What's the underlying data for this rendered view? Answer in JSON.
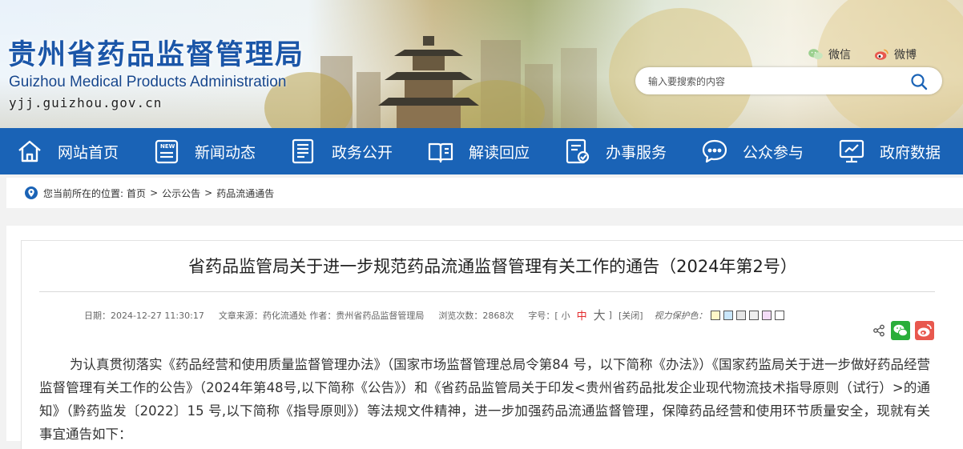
{
  "header": {
    "site_title": "贵州省药品监督管理局",
    "site_subtitle": "Guizhou Medical Products Administration",
    "site_domain": "yjj.guizhou.gov.cn",
    "wechat_label": "微信",
    "weibo_label": "微博",
    "search_placeholder": "输入要搜索的内容"
  },
  "nav": {
    "items": [
      {
        "label": "网站首页",
        "icon": "home-icon"
      },
      {
        "label": "新闻动态",
        "icon": "news-icon"
      },
      {
        "label": "政务公开",
        "icon": "document-icon"
      },
      {
        "label": "解读回应",
        "icon": "book-icon"
      },
      {
        "label": "办事服务",
        "icon": "service-icon"
      },
      {
        "label": "公众参与",
        "icon": "chat-icon"
      },
      {
        "label": "政府数据",
        "icon": "data-icon"
      }
    ]
  },
  "breadcrumb": {
    "prefix": "您当前所在的位置:",
    "items": [
      "首页",
      "公示公告",
      "药品流通通告"
    ],
    "separator": ">"
  },
  "article": {
    "title": "省药品监管局关于进一步规范药品流通监督管理有关工作的通告（2024年第2号）",
    "date": "日期：2024-12-27 11:30:17",
    "source": "文章来源：药化流通处 作者：贵州省药品监督管理局",
    "views": "浏览次数：2868次",
    "font_size_label": "字号：[",
    "font_small": "小",
    "font_medium": "中",
    "font_large": "大",
    "font_close": "]",
    "close_label": "[关闭]",
    "eye_protect_label": "视力保护色：",
    "swatch_colors": [
      "#fff6c8",
      "#c9e6fb",
      "#e6e6e6",
      "#eeeeee",
      "#f4dcf7",
      "#ffffff"
    ],
    "body": "为认真贯彻落实《药品经营和使用质量监督管理办法》（国家市场监督管理总局令第84 号，以下简称《办法》）《国家药监局关于进一步做好药品经营监督管理有关工作的公告》（2024年第48号,以下简称《公告》）和《省药品监管局关于印发<贵州省药品批发企业现代物流技术指导原则（试行）>的通知》（黔药监发〔2022〕15 号,以下简称《指导原则》）等法规文件精神，进一步加强药品流通监督管理，保障药品经营和使用环节质量安全，现就有关事宜通告如下："
  },
  "colors": {
    "nav_bg": "#1a63b6",
    "title_blue": "#1b56a8",
    "accent_red": "#e3292b",
    "wechat_green": "#2aae3a",
    "weibo_red": "#e8584e"
  }
}
